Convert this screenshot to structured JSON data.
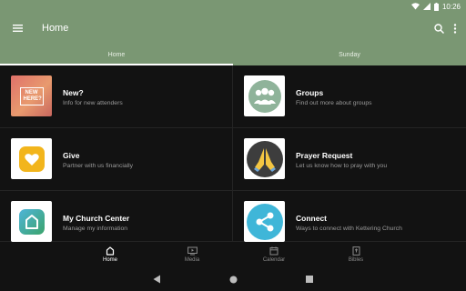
{
  "status": {
    "time": "10:26"
  },
  "app_bar": {
    "title": "Home"
  },
  "tabs": [
    {
      "label": "Home",
      "active": true
    },
    {
      "label": "Sunday",
      "active": false
    }
  ],
  "cards": [
    {
      "title": "New?",
      "subtitle": "Info for new attenders",
      "thumb_text": "NEW HERE?"
    },
    {
      "title": "Groups",
      "subtitle": "Find out more about groups"
    },
    {
      "title": "Give",
      "subtitle": "Partner with us financially"
    },
    {
      "title": "Prayer Request",
      "subtitle": "Let us know how to pray with you"
    },
    {
      "title": "My Church Center",
      "subtitle": "Manage my information"
    },
    {
      "title": "Connect",
      "subtitle": "Ways to connect with  Kettering Church"
    }
  ],
  "bottom_nav": [
    {
      "label": "Home",
      "active": true
    },
    {
      "label": "Media",
      "active": false
    },
    {
      "label": "Calendar",
      "active": false
    },
    {
      "label": "Bibles",
      "active": false
    }
  ],
  "colors": {
    "brand": "#7a9773",
    "background": "#121212"
  }
}
